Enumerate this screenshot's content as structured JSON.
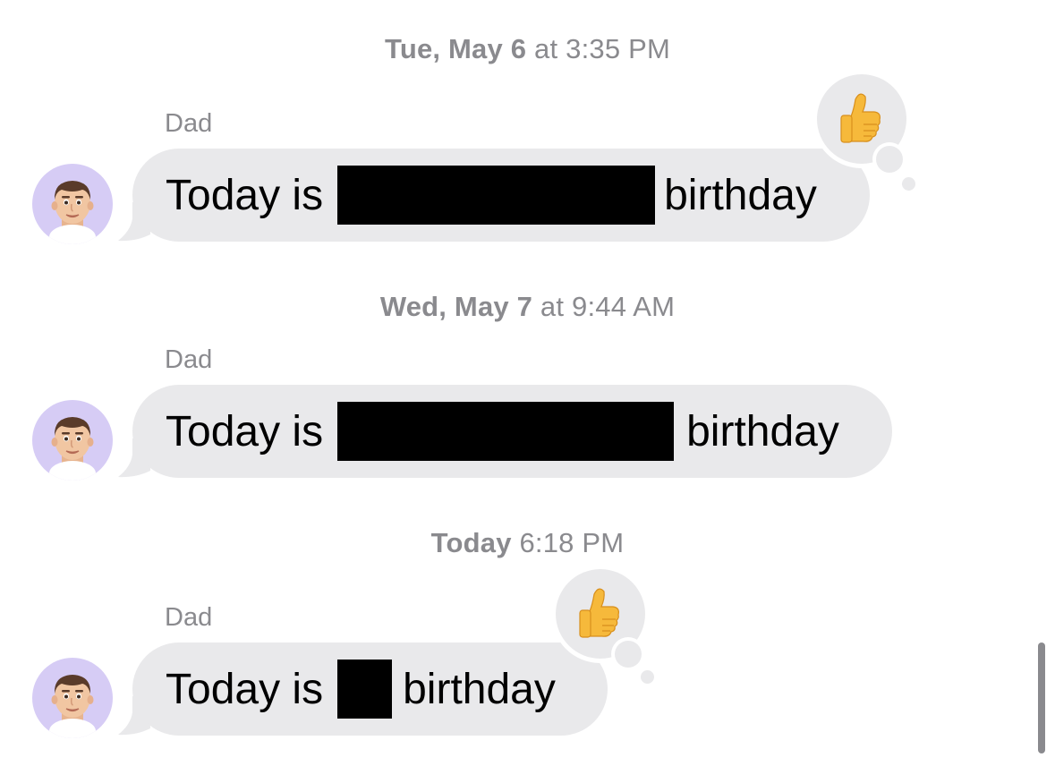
{
  "conversation": {
    "groups": [
      {
        "timestamp": {
          "day": "Tue, May 6",
          "sep": "at",
          "time": "3:35 PM"
        },
        "sender": "Dad",
        "message": {
          "before": "Today is",
          "after": "birthday"
        },
        "reaction": "thumbs-up-icon"
      },
      {
        "timestamp": {
          "day": "Wed, May 7",
          "sep": "at",
          "time": "9:44 AM"
        },
        "sender": "Dad",
        "message": {
          "before": "Today is",
          "after": "birthday"
        },
        "reaction": null
      },
      {
        "timestamp": {
          "day": "Today",
          "sep": "",
          "time": "6:18 PM"
        },
        "sender": "Dad",
        "message": {
          "before": "Today is",
          "after": "birthday"
        },
        "reaction": "thumbs-up-icon"
      }
    ]
  },
  "colors": {
    "bubble_gray": "#e9e9eb",
    "meta_gray": "#8a8a8e",
    "avatar_bg": "#d6ccf5",
    "redaction": "#000000",
    "thumbs_up": "#f6b93b"
  }
}
